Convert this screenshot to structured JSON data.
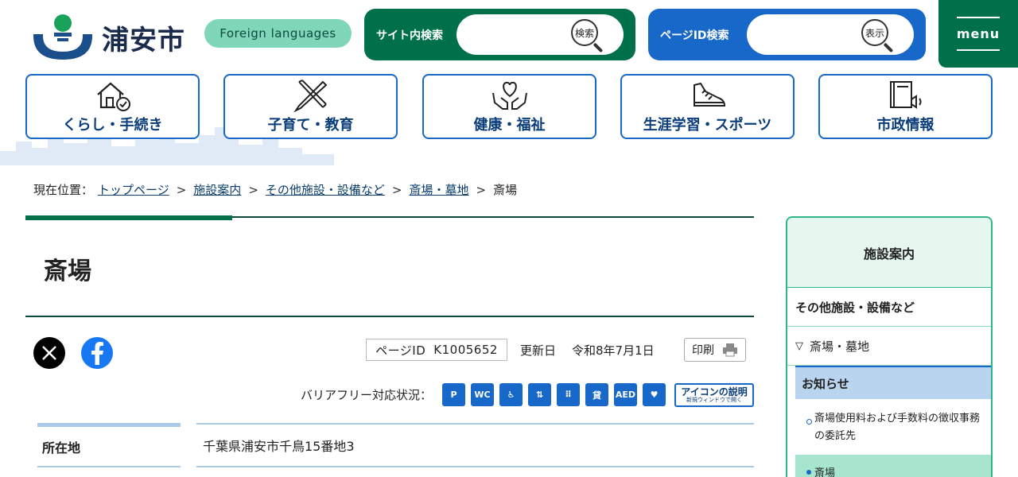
{
  "header": {
    "logo_text": "浦安市",
    "foreign_languages": "Foreign languages",
    "site_search": {
      "label": "サイト内検索",
      "button": "検索",
      "placeholder": ""
    },
    "page_id_search": {
      "label": "ページID検索",
      "button": "表示",
      "placeholder": ""
    },
    "menu_label": "menu"
  },
  "nav": [
    {
      "label": "くらし・手続き",
      "icon": "house-check-icon"
    },
    {
      "label": "子育て・教育",
      "icon": "pencil-ruler-icon"
    },
    {
      "label": "健康・福祉",
      "icon": "heart-hands-icon"
    },
    {
      "label": "生涯学習・スポーツ",
      "icon": "shoe-icon"
    },
    {
      "label": "市政情報",
      "icon": "book-megaphone-icon"
    }
  ],
  "breadcrumb": {
    "prefix": "現在位置：",
    "items": [
      "トップページ",
      "施設案内",
      "その他施設・設備など",
      "斎場・墓地"
    ],
    "current": "斎場",
    "separator": ">"
  },
  "page": {
    "title": "斎場",
    "page_id_label": "ページID",
    "page_id_value": "K1005652",
    "updated_label": "更新日",
    "updated_value": "令和8年7月1日",
    "print_label": "印刷",
    "barrier_free_label": "バリアフリー対応状況：",
    "barrier_free_icons": [
      "P",
      "WC",
      "♿",
      "⇅",
      "⠿",
      "貸",
      "AED",
      "♥"
    ],
    "icon_explain_main": "アイコンの説明",
    "icon_explain_sub": "新規ウィンドウで開く",
    "info": [
      {
        "label": "所在地",
        "value": "千葉県浦安市千鳥15番地3"
      }
    ]
  },
  "sidebar": {
    "title": "施設案内",
    "category": "その他施設・設備など",
    "subcategory": "斎場・墓地",
    "news_heading": "お知らせ",
    "links": [
      "斎場使用料および手数料の徴収事務の委託先"
    ],
    "current": "斎場"
  },
  "colors": {
    "green": "#00704a",
    "blue": "#1768c8",
    "mint": "#7fd6b8"
  }
}
